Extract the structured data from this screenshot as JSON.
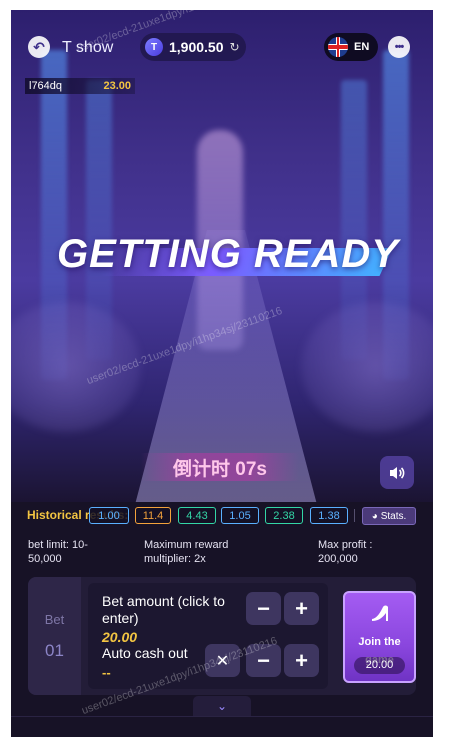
{
  "header": {
    "show_title": "T show",
    "balance": "1,900.50",
    "language": "EN"
  },
  "player": {
    "name": "l764dq",
    "amount": "23.00"
  },
  "stage": {
    "status_text": "GETTING READY",
    "countdown": "倒计时 07s"
  },
  "history": {
    "label": "Historical results:",
    "values": [
      "1.00",
      "11.4",
      "4.43",
      "1.05",
      "2.38",
      "1.38"
    ],
    "colors": [
      "#5ab0ff",
      "#f3a23b",
      "#33d6a6",
      "#5ab0ff",
      "#33d6a6",
      "#5ab0ff"
    ],
    "stats_label": "Stats."
  },
  "info": {
    "bet_limit": "bet limit: 10-50,000",
    "max_reward": "Maximum reward multiplier: 2x",
    "max_profit": "Max profit : 200,000"
  },
  "bet": {
    "tab_label": "Bet",
    "tab_number": "01",
    "amount_label": "Bet amount (click to enter)",
    "amount_value": "20.00",
    "auto_cashout_label": "Auto cash out",
    "auto_cashout_value": "--",
    "join_label": "Join the game",
    "join_amount": "20.00"
  },
  "watermark": "user02/ecd-21uxe1dpy/i1hp34sj/23110216",
  "icons": {
    "back": "back-arrow-icon",
    "balance": "coin-icon",
    "refresh": "refresh-icon",
    "language": "uk-flag-icon",
    "more": "more-dots-icon",
    "sound": "speaker-icon",
    "stats": "stats-icon",
    "join": "high-heel-icon",
    "expand": "chevron-down-icon"
  }
}
